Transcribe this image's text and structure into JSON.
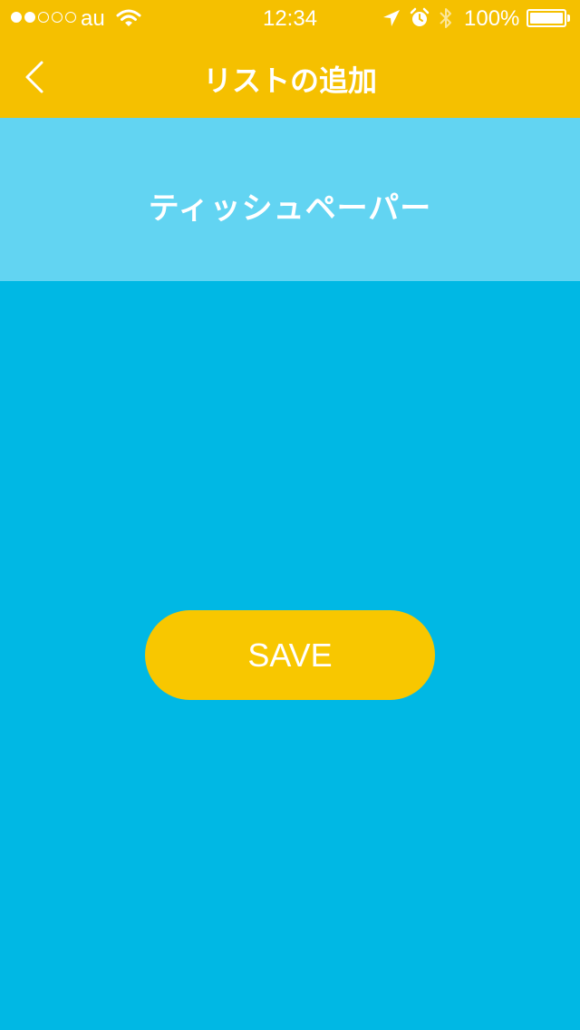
{
  "status_bar": {
    "carrier": "au",
    "time": "12:34",
    "battery_percent": "100%",
    "signal_bars_filled": 2,
    "signal_bars_total": 5,
    "icons": [
      "wifi-icon",
      "location-arrow-icon",
      "alarm-icon",
      "bluetooth-icon",
      "battery-icon"
    ]
  },
  "nav": {
    "title": "リストの追加",
    "back_icon": "chevron-left-icon"
  },
  "item": {
    "name": "ティッシュペーパー"
  },
  "save_button": {
    "label": "SAVE"
  },
  "colors": {
    "header": "#f5c000",
    "item_field": "#62d4f2",
    "background": "#00b8e4",
    "button": "#f8c700",
    "text": "#ffffff"
  }
}
